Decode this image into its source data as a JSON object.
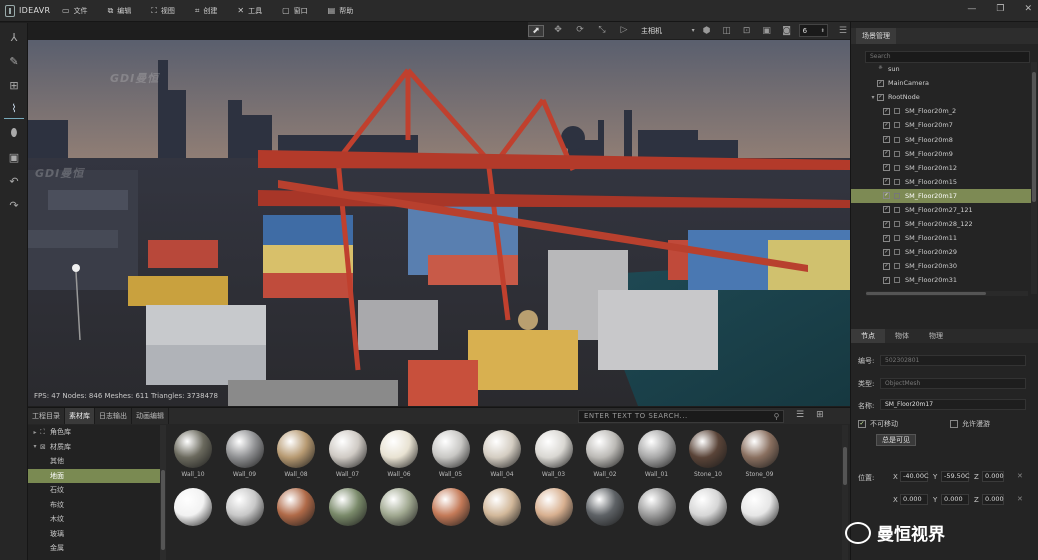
{
  "app": {
    "title": "IDEAVR"
  },
  "menu": [
    {
      "icon": "file-icon",
      "glyph": "▭",
      "label": "文件"
    },
    {
      "icon": "edit-icon",
      "glyph": "⧉",
      "label": "编辑"
    },
    {
      "icon": "view-icon",
      "glyph": "⛶",
      "label": "视图"
    },
    {
      "icon": "create-icon",
      "glyph": "⌗",
      "label": "创建"
    },
    {
      "icon": "tools-icon",
      "glyph": "✕",
      "label": "工具"
    },
    {
      "icon": "window-icon",
      "glyph": "▢",
      "label": "窗口"
    },
    {
      "icon": "help-icon",
      "glyph": "▤",
      "label": "帮助"
    }
  ],
  "window_controls": [
    "—",
    "❐",
    "✕"
  ],
  "left_tools": [
    {
      "name": "transform-axes-icon",
      "glyph": "⅄"
    },
    {
      "name": "edit-panel-icon",
      "glyph": "✎"
    },
    {
      "name": "hierarchy-icon",
      "glyph": "⊞"
    },
    {
      "name": "chart-icon",
      "glyph": "⌇",
      "active": true
    },
    {
      "name": "link-icon",
      "glyph": "⬮"
    },
    {
      "name": "media-icon",
      "glyph": "▣"
    },
    {
      "name": "undo-icon",
      "glyph": "↶"
    },
    {
      "name": "redo-icon",
      "glyph": "↷"
    }
  ],
  "viewport_toolbar": {
    "camera": "主相机",
    "camera_speed": "6",
    "tools": [
      {
        "name": "select-tool-icon",
        "glyph": "⬈",
        "selected": true
      },
      {
        "name": "move-tool-icon",
        "glyph": "✥"
      },
      {
        "name": "rotate-tool-icon",
        "glyph": "⟳"
      },
      {
        "name": "scale-tool-icon",
        "glyph": "⤡"
      },
      {
        "name": "play-icon",
        "glyph": "▷"
      }
    ],
    "right_tools": [
      {
        "name": "render-mode-icon",
        "glyph": "⬢"
      },
      {
        "name": "snap-icon",
        "glyph": "◫"
      },
      {
        "name": "grid-icon",
        "glyph": "⊡"
      },
      {
        "name": "display-icon",
        "glyph": "▣"
      },
      {
        "name": "camera-settings-icon",
        "glyph": "◙"
      }
    ]
  },
  "viewport": {
    "stats": "FPS: 47   Nodes: 846   Meshes: 611   Triangles: 3738478"
  },
  "bottom_tabs": [
    {
      "label": "工程目录",
      "active": false
    },
    {
      "label": "素材库",
      "active": true
    },
    {
      "label": "日志输出",
      "active": false
    },
    {
      "label": "动画编辑",
      "active": false
    }
  ],
  "asset_search": {
    "placeholder": "ENTER TEXT TO SEARCH..."
  },
  "library_tree": [
    {
      "label": "角色库",
      "level": 0,
      "expander": "▸",
      "icon": "⛶",
      "selected": false
    },
    {
      "label": "材质库",
      "level": 0,
      "expander": "▾",
      "icon": "⊠",
      "selected": false
    },
    {
      "label": "其他",
      "level": 1,
      "selected": false
    },
    {
      "label": "地面",
      "level": 1,
      "selected": true
    },
    {
      "label": "石纹",
      "level": 1,
      "selected": false
    },
    {
      "label": "布纹",
      "level": 1,
      "selected": false
    },
    {
      "label": "木纹",
      "level": 1,
      "selected": false
    },
    {
      "label": "玻璃",
      "level": 1,
      "selected": false
    },
    {
      "label": "金属",
      "level": 1,
      "selected": false
    }
  ],
  "materials_row1": [
    {
      "label": "Wall_10",
      "color": "#6b6a5e"
    },
    {
      "label": "Wall_09",
      "color": "#8f9092"
    },
    {
      "label": "Wall_08",
      "color": "#b79a72"
    },
    {
      "label": "Wall_07",
      "color": "#cfcac4"
    },
    {
      "label": "Wall_06",
      "color": "#e8e2d2"
    },
    {
      "label": "Wall_05",
      "color": "#c8c7c4"
    },
    {
      "label": "Wall_04",
      "color": "#d4cdc2"
    },
    {
      "label": "Wall_03",
      "color": "#d9d7d2"
    },
    {
      "label": "Wall_02",
      "color": "#bcbab6"
    },
    {
      "label": "Wall_01",
      "color": "#a8a8a8"
    },
    {
      "label": "Stone_10",
      "color": "#5a4438"
    },
    {
      "label": "Stone_09",
      "color": "#8a7060"
    }
  ],
  "materials_row2": [
    {
      "color": "#f2f2f2"
    },
    {
      "color": "#c8c8c8"
    },
    {
      "color": "#b06a48"
    },
    {
      "color": "#7a8a6a"
    },
    {
      "color": "#a0a890"
    },
    {
      "color": "#c47a58"
    },
    {
      "color": "#d2b89a"
    },
    {
      "color": "#d8b090"
    },
    {
      "color": "#5e6266"
    },
    {
      "color": "#9a9a9a"
    },
    {
      "color": "#d6d6d6"
    },
    {
      "color": "#e6e6e6"
    }
  ],
  "scene_manager": {
    "tab": "场景管理",
    "search_placeholder": "Search",
    "nodes": [
      {
        "label": "sun",
        "level": 1,
        "expander": "",
        "check": false
      },
      {
        "label": "MainCamera",
        "level": 1,
        "expander": "",
        "check": true
      },
      {
        "label": "RootNode",
        "level": 1,
        "expander": "▾",
        "check": true
      },
      {
        "label": "SM_Floor20m_2",
        "level": 2,
        "expander": "",
        "check": true,
        "selected": false
      },
      {
        "label": "SM_Floor20m7",
        "level": 2,
        "expander": "",
        "check": true,
        "selected": false
      },
      {
        "label": "SM_Floor20m8",
        "level": 2,
        "expander": "",
        "check": true,
        "selected": false
      },
      {
        "label": "SM_Floor20m9",
        "level": 2,
        "expander": "",
        "check": true,
        "selected": false
      },
      {
        "label": "SM_Floor20m12",
        "level": 2,
        "expander": "",
        "check": true,
        "selected": false
      },
      {
        "label": "SM_Floor20m15",
        "level": 2,
        "expander": "",
        "check": true,
        "selected": false
      },
      {
        "label": "SM_Floor20m17",
        "level": 2,
        "expander": "",
        "check": true,
        "selected": true
      },
      {
        "label": "SM_Floor20m27_121",
        "level": 2,
        "expander": "",
        "check": true,
        "selected": false
      },
      {
        "label": "SM_Floor20m28_122",
        "level": 2,
        "expander": "",
        "check": true,
        "selected": false
      },
      {
        "label": "SM_Floor20m11",
        "level": 2,
        "expander": "",
        "check": true,
        "selected": false
      },
      {
        "label": "SM_Floor20m29",
        "level": 2,
        "expander": "",
        "check": true,
        "selected": false
      },
      {
        "label": "SM_Floor20m30",
        "level": 2,
        "expander": "",
        "check": true,
        "selected": false
      },
      {
        "label": "SM_Floor20m31",
        "level": 2,
        "expander": "",
        "check": true,
        "selected": false
      }
    ]
  },
  "properties": {
    "tabs": [
      {
        "label": "节点",
        "active": true
      },
      {
        "label": "物体",
        "active": false
      },
      {
        "label": "物理",
        "active": false
      }
    ],
    "id_label": "编号:",
    "id_value": "502302801",
    "type_label": "类型:",
    "type_value": "ObjectMesh",
    "name_label": "名称:",
    "name_value": "SM_Floor20m17",
    "immovable_label": "不可移动",
    "allow_roam_label": "允许漫游",
    "always_visible_label": "总是可见",
    "position_label": "位置:",
    "position": {
      "x": "-40.00C",
      "y": "-59.50C",
      "z": "0.000"
    },
    "row2": {
      "x": "0.000",
      "y": "0.000",
      "z": "0.000"
    }
  },
  "watermark": {
    "text": "曼恒视界",
    "overlay": "GDI曼恒"
  }
}
